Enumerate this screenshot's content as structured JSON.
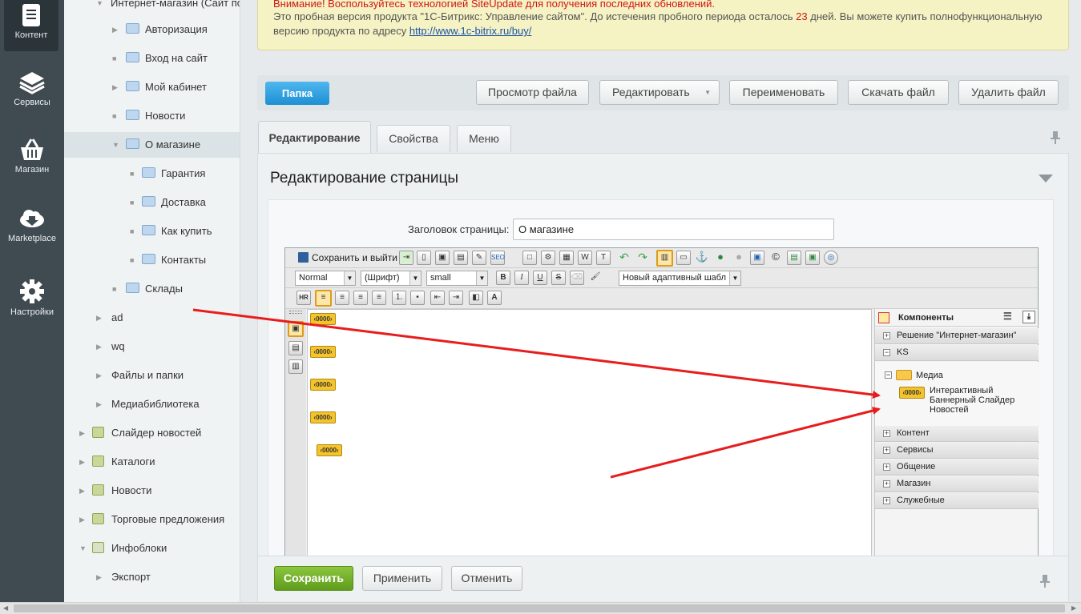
{
  "leftbar": {
    "items": [
      {
        "label": "Контент",
        "icon": "document-icon"
      },
      {
        "label": "Сервисы",
        "icon": "layers-icon"
      },
      {
        "label": "Магазин",
        "icon": "basket-icon"
      },
      {
        "label": "Marketplace",
        "icon": "cloud-download-icon"
      },
      {
        "label": "Настройки",
        "icon": "gear-icon"
      }
    ]
  },
  "tree": {
    "items": [
      {
        "label": "Интернет-магазин (Сайт по"
      },
      {
        "label": "Авторизация"
      },
      {
        "label": "Вход на сайт"
      },
      {
        "label": "Мой кабинет"
      },
      {
        "label": "Новости"
      },
      {
        "label": "О магазине"
      },
      {
        "label": "Гарантия"
      },
      {
        "label": "Доставка"
      },
      {
        "label": "Как купить"
      },
      {
        "label": "Контакты"
      },
      {
        "label": "Склады"
      },
      {
        "label": "ad"
      },
      {
        "label": "wq"
      },
      {
        "label": "Файлы и папки"
      },
      {
        "label": "Медиабиблиотека"
      },
      {
        "label": "Слайдер новостей"
      },
      {
        "label": "Каталоги"
      },
      {
        "label": "Новости"
      },
      {
        "label": "Торговые предложения"
      },
      {
        "label": "Инфоблоки"
      },
      {
        "label": "Экспорт"
      }
    ]
  },
  "notice": {
    "line1": "Внимание! Воспользуйтесь технологией SiteUpdate для получения последних обновлений.",
    "line2_pre": "Это пробная версия продукта \"1С-Битрикс: Управление сайтом\". До истечения пробного периода осталось",
    "days": "23",
    "line2_post": "дней. Вы можете купить полнофункциональную",
    "line3_pre": "версию продукта по адресу",
    "link": "http://www.1c-bitrix.ru/buy/"
  },
  "toolbar": {
    "folder": "Папка",
    "view": "Просмотр файла",
    "edit": "Редактировать",
    "rename": "Переименовать",
    "download": "Скачать файл",
    "delete": "Удалить файл"
  },
  "tabs": [
    "Редактирование",
    "Свойства",
    "Меню"
  ],
  "panel": {
    "title": "Редактирование страницы",
    "page_title_label": "Заголовок страницы:",
    "page_title_value": "О магазине"
  },
  "editor": {
    "save_exit": "Сохранить и выйти",
    "style_select": "Normal",
    "font_select": "(Шрифт)",
    "size_select": "small",
    "template_select": "Новый адаптивный шабл",
    "components_title": "Компоненты",
    "groups": [
      {
        "label": "Решение \"Интернет-магазин\"",
        "sign": "+"
      },
      {
        "label": "KS",
        "sign": "−"
      },
      {
        "label": "Контент",
        "sign": "+"
      },
      {
        "label": "Сервисы",
        "sign": "+"
      },
      {
        "label": "Общение",
        "sign": "+"
      },
      {
        "label": "Магазин",
        "sign": "+"
      },
      {
        "label": "Служебные",
        "sign": "+"
      }
    ],
    "media_folder": "Медиа",
    "component_name": "Интерактивный Баннерный Слайдер Новостей",
    "tag_text": "‹0000›"
  },
  "bottom": {
    "save": "Сохранить",
    "apply": "Применить",
    "cancel": "Отменить"
  },
  "colors": {
    "annotation_arrow": "#e81c1c",
    "save_button": "#6aa81e"
  }
}
